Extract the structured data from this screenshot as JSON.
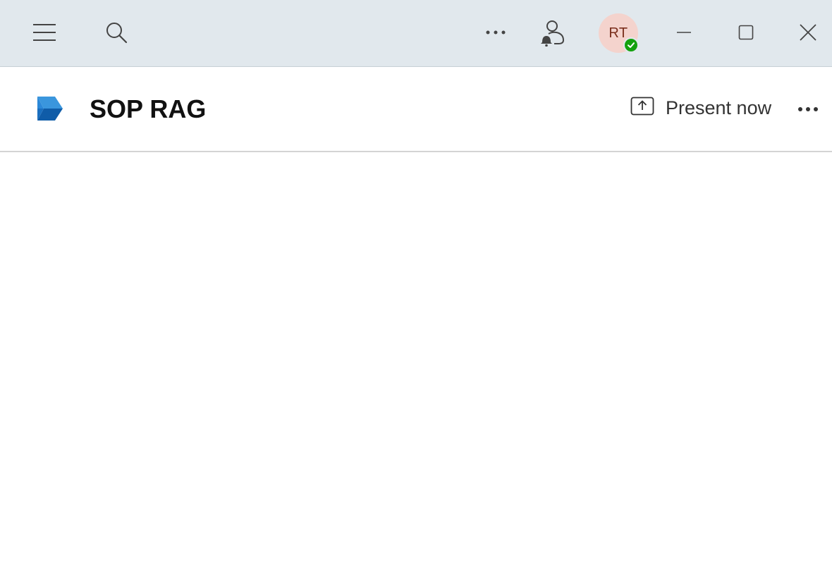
{
  "titlebar": {
    "icons": {
      "menu": "hamburger-icon",
      "search": "search-icon",
      "more": "more-horizontal-icon",
      "presence": "person-bell-icon",
      "minimize": "minimize-icon",
      "maximize": "maximize-icon",
      "close": "close-icon"
    },
    "avatar": {
      "initials": "RT",
      "status": "available",
      "status_color": "#13a10e",
      "bg_color": "#f4d3cd"
    }
  },
  "header": {
    "title": "SOP RAG",
    "present_label": "Present now",
    "logo_icon": "power-automate-logo-icon",
    "present_icon": "share-screen-icon",
    "more_icon": "more-horizontal-icon"
  },
  "colors": {
    "titlebar_bg": "#e1e8ed",
    "logo_light_blue": "#2b88d8",
    "logo_dark_blue": "#0f5ca8"
  }
}
